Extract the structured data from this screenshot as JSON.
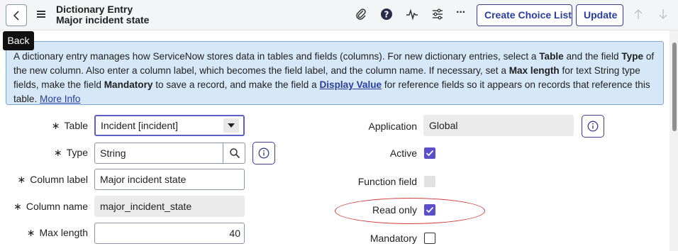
{
  "header": {
    "title_line1": "Dictionary Entry",
    "title_line2": "Major incident state",
    "create_choice_label": "Create Choice List",
    "update_label": "Update",
    "more_label": "···"
  },
  "tooltip": {
    "text": "Back"
  },
  "info": {
    "p1": "A dictionary entry manages how ServiceNow stores data in tables and fields (columns). For new dictionary entries, select a ",
    "b1": "Table",
    "p2": " and the field ",
    "b2": "Type",
    "p3": " of the new column. Also enter a column label, which becomes the field label, and the column name. If necessary, set a ",
    "b3": "Max length",
    "p4": " for text String type fields, make the field ",
    "b4": "Mandatory",
    "p5": " to save a record, and make the field a ",
    "b5": "Display Value",
    "p6": " for reference fields so it appears on records that reference this table. ",
    "link": "More Info"
  },
  "form": {
    "required_mark": "∗",
    "table_label": "Table",
    "table_value": "Incident [incident]",
    "type_label": "Type",
    "type_value": "String",
    "column_label_label": "Column label",
    "column_label_value": "Major incident state",
    "column_name_label": "Column name",
    "column_name_value": "major_incident_state",
    "max_length_label": "Max length",
    "max_length_value": "40",
    "application_label": "Application",
    "application_value": "Global",
    "active_label": "Active",
    "active_checked": true,
    "function_field_label": "Function field",
    "function_field_checked": false,
    "read_only_label": "Read only",
    "read_only_checked": true,
    "mandatory_label": "Mandatory",
    "mandatory_checked": false
  },
  "colors": {
    "accent": "#5b4fc7",
    "brand_button": "#293e9b",
    "highlight_ellipse": "#d13b3b",
    "info_bg": "#d6e8f8"
  }
}
